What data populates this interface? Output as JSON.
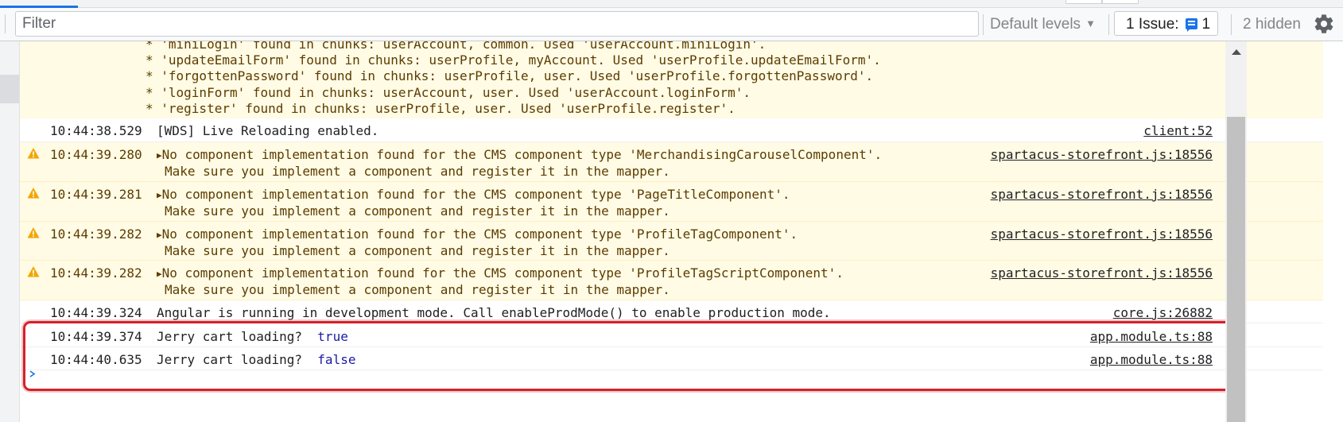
{
  "toolbar": {
    "filter_placeholder": "Filter",
    "levels_label": "Default levels",
    "issues_label": "1 Issue:",
    "issues_count": "1",
    "hidden_label": "2 hidden"
  },
  "preamble": [
    "* 'miniLogin' found in chunks: userAccount, common. Used 'userAccount.miniLogin'.",
    "* 'updateEmailForm' found in chunks: userProfile, myAccount. Used 'userProfile.updateEmailForm'.",
    "* 'forgottenPassword' found in chunks: userProfile, user. Used 'userProfile.forgottenPassword'.",
    "* 'loginForm' found in chunks: userAccount, user. Used 'userAccount.loginForm'.",
    "* 'register' found in chunks: userProfile, user. Used 'userProfile.register'."
  ],
  "rows": [
    {
      "time": "10:44:38.529",
      "message": "[WDS] Live Reloading enabled.",
      "source": "client:52"
    },
    {
      "time": "10:44:39.280",
      "message": "No component implementation found for the CMS component type 'MerchandisingCarouselComponent'.",
      "message2": "Make sure you implement a component and register it in the mapper.",
      "source": "spartacus-storefront.js:18556"
    },
    {
      "time": "10:44:39.281",
      "message": "No component implementation found for the CMS component type 'PageTitleComponent'.",
      "message2": "Make sure you implement a component and register it in the mapper.",
      "source": "spartacus-storefront.js:18556"
    },
    {
      "time": "10:44:39.282",
      "message": "No component implementation found for the CMS component type 'ProfileTagComponent'.",
      "message2": "Make sure you implement a component and register it in the mapper.",
      "source": "spartacus-storefront.js:18556"
    },
    {
      "time": "10:44:39.282",
      "message": "No component implementation found for the CMS component type 'ProfileTagScriptComponent'.",
      "message2": "Make sure you implement a component and register it in the mapper.",
      "source": "spartacus-storefront.js:18556"
    },
    {
      "time": "10:44:39.324",
      "message": "Angular is running in development mode. Call enableProdMode() to enable production mode.",
      "source": "core.js:26882"
    },
    {
      "time": "10:44:39.374",
      "message": "Jerry cart loading?",
      "value": "true",
      "source": "app.module.ts:88"
    },
    {
      "time": "10:44:40.635",
      "message": "Jerry cart loading?",
      "value": "false",
      "source": "app.module.ts:88"
    }
  ],
  "colors": {
    "warning_bg": "#fffbe5",
    "warning_icon": "#f2a600",
    "highlight_border": "#d1232a",
    "boolean_value": "#1a1aa6",
    "accent": "#1a73e8"
  },
  "icons": {
    "warning": "warning-icon",
    "expand": "expand-triangle-icon",
    "settings": "gear-icon",
    "issue": "issue-message-icon"
  }
}
